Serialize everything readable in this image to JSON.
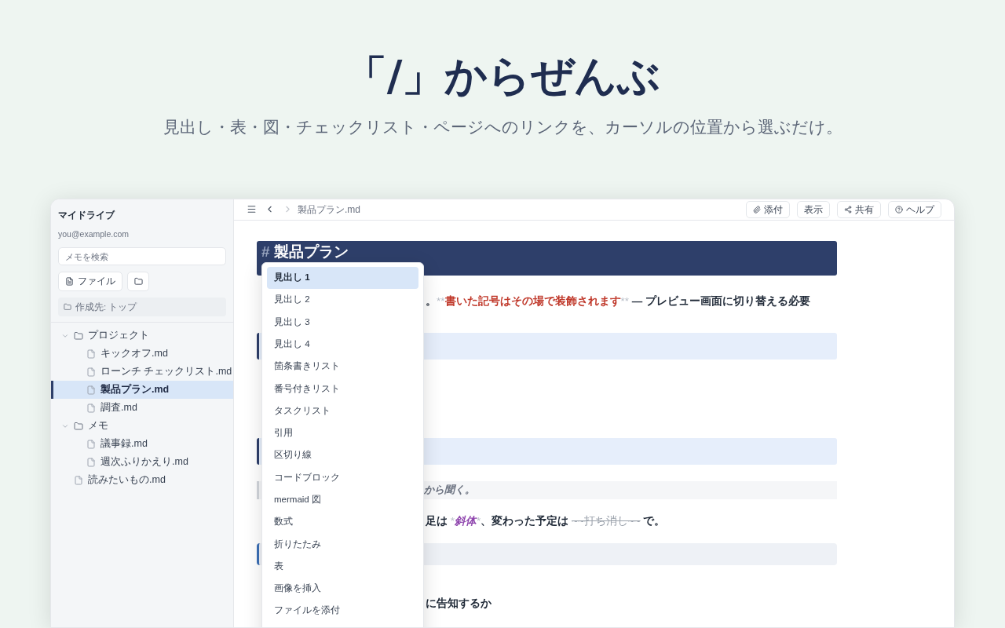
{
  "hero": {
    "title": "「/」からぜんぶ",
    "subtitle": "見出し・表・図・チェックリスト・ページへのリンクを、カーソルの位置から選ぶだけ。"
  },
  "sidebar": {
    "title": "マイドライブ",
    "email": "you@example.com",
    "search": {
      "placeholder": "メモを検索"
    },
    "new_file_button": "ファイル",
    "destination": "作成先: トップ",
    "tree": [
      {
        "kind": "folder",
        "label": "プロジェクト",
        "expanded": true,
        "selected": false,
        "children": [
          {
            "kind": "file",
            "label": "キックオフ.md",
            "selected": false
          },
          {
            "kind": "file",
            "label": "ローンチ チェックリスト.md",
            "selected": false
          },
          {
            "kind": "file",
            "label": "製品プラン.md",
            "selected": true
          },
          {
            "kind": "file",
            "label": "調査.md",
            "selected": false
          }
        ]
      },
      {
        "kind": "folder",
        "label": "メモ",
        "expanded": true,
        "selected": false,
        "children": [
          {
            "kind": "file",
            "label": "議事録.md",
            "selected": false
          },
          {
            "kind": "file",
            "label": "週次ふりかえり.md",
            "selected": false
          }
        ]
      },
      {
        "kind": "file",
        "label": "読みたいもの.md",
        "selected": false
      }
    ]
  },
  "toolbar": {
    "breadcrumb": "製品プラン.md",
    "buttons": [
      {
        "kind": "attach",
        "label": "添付"
      },
      {
        "kind": "plain",
        "label": "表示"
      },
      {
        "kind": "share",
        "label": "共有"
      },
      {
        "kind": "help",
        "label": "ヘルプ"
      }
    ]
  },
  "editor": {
    "blocks": [
      {
        "kind": "heading",
        "segments": [
          {
            "kind": "marker",
            "text": "#"
          },
          {
            "kind": "text",
            "text": " 製品プラン"
          }
        ]
      },
      {
        "kind": "paragraph",
        "segments": [
          {
            "kind": "text",
            "text": "。"
          },
          {
            "kind": "marker",
            "text": "**"
          },
          {
            "kind": "red",
            "text": "書いた記号はその場で装飾されます"
          },
          {
            "kind": "marker",
            "text": "**"
          },
          {
            "kind": "text",
            "text": " — プレビュー画面に切り替える必要"
          }
        ]
      },
      {
        "kind": "band"
      },
      {
        "kind": "band"
      },
      {
        "kind": "quote",
        "segments": [
          {
            "kind": "italic",
            "text": "から聞く。"
          }
        ]
      },
      {
        "kind": "paragraph",
        "segments": [
          {
            "kind": "text",
            "text": "足は "
          },
          {
            "kind": "marker",
            "text": "*"
          },
          {
            "kind": "purple",
            "text": "斜体"
          },
          {
            "kind": "marker",
            "text": "*"
          },
          {
            "kind": "text",
            "text": "、変わった予定は "
          },
          {
            "kind": "strike",
            "text": "~~打ち消し~~"
          },
          {
            "kind": "text",
            "text": " で。"
          }
        ]
      },
      {
        "kind": "code"
      },
      {
        "kind": "paragraph",
        "segments": [
          {
            "kind": "text",
            "text": "に告知するか"
          }
        ]
      }
    ]
  },
  "slash_menu": {
    "items": [
      {
        "label": "見出し 1",
        "selected": true
      },
      {
        "label": "見出し 2",
        "selected": false
      },
      {
        "label": "見出し 3",
        "selected": false
      },
      {
        "label": "見出し 4",
        "selected": false
      },
      {
        "label": "箇条書きリスト",
        "selected": false
      },
      {
        "label": "番号付きリスト",
        "selected": false
      },
      {
        "label": "タスクリスト",
        "selected": false
      },
      {
        "label": "引用",
        "selected": false
      },
      {
        "label": "区切り線",
        "selected": false
      },
      {
        "label": "コードブロック",
        "selected": false
      },
      {
        "label": "mermaid 図",
        "selected": false
      },
      {
        "label": "数式",
        "selected": false
      },
      {
        "label": "折りたたみ",
        "selected": false
      },
      {
        "label": "表",
        "selected": false
      },
      {
        "label": "画像を挿入",
        "selected": false
      },
      {
        "label": "ファイルを添付",
        "selected": false
      }
    ]
  }
}
